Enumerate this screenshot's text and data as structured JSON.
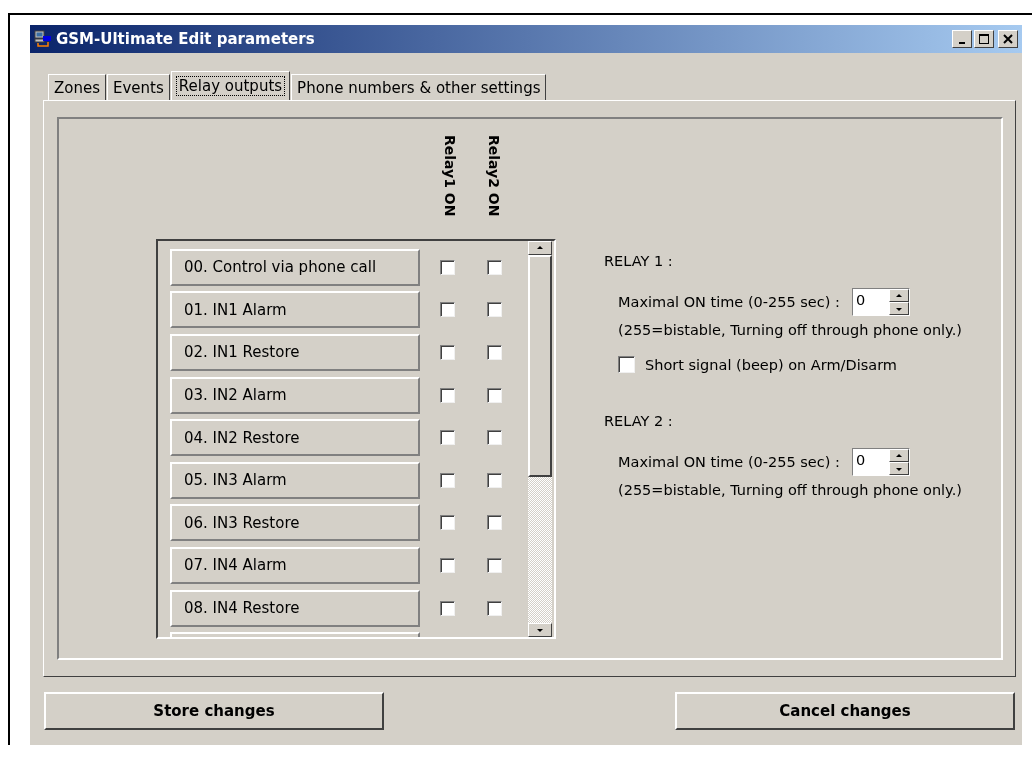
{
  "window": {
    "title": "GSM-Ultimate Edit parameters"
  },
  "tabs": [
    {
      "label": "Zones",
      "selected": false
    },
    {
      "label": "Events",
      "selected": false
    },
    {
      "label": "Relay outputs",
      "selected": true
    },
    {
      "label": "Phone numbers & other settings",
      "selected": false
    }
  ],
  "columns": [
    "Relay1 ON",
    "Relay2 ON"
  ],
  "events": [
    {
      "label": "00. Control via phone call",
      "relay1": false,
      "relay2": false
    },
    {
      "label": "01. IN1 Alarm",
      "relay1": false,
      "relay2": false
    },
    {
      "label": "02. IN1 Restore",
      "relay1": false,
      "relay2": false
    },
    {
      "label": "03. IN2 Alarm",
      "relay1": false,
      "relay2": false
    },
    {
      "label": "04. IN2 Restore",
      "relay1": false,
      "relay2": false
    },
    {
      "label": "05. IN3 Alarm",
      "relay1": false,
      "relay2": false
    },
    {
      "label": "06. IN3 Restore",
      "relay1": false,
      "relay2": false
    },
    {
      "label": "07. IN4 Alarm",
      "relay1": false,
      "relay2": false
    },
    {
      "label": "08. IN4 Restore",
      "relay1": false,
      "relay2": false
    }
  ],
  "relays": [
    {
      "heading": "RELAY 1 :",
      "time_label": "Maximal ON time (0-255 sec) :",
      "time_value": "0",
      "note": "(255=bistable, Turning off through phone only.)",
      "beep": {
        "label": "Short signal (beep) on Arm/Disarm",
        "checked": false
      }
    },
    {
      "heading": "RELAY 2 :",
      "time_label": "Maximal ON time (0-255 sec) :",
      "time_value": "0",
      "note": "(255=bistable, Turning off through phone only.)"
    }
  ],
  "buttons": [
    "Store changes",
    "Cancel changes"
  ]
}
